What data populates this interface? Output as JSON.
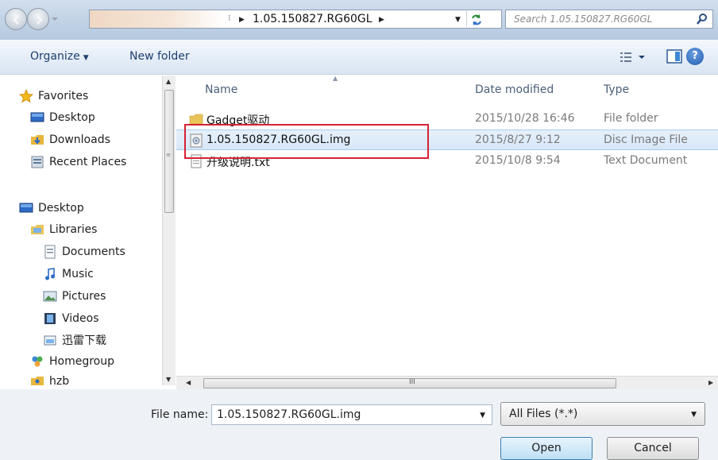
{
  "address": {
    "overflow_glyph": "⁝",
    "current_folder": "1.05.150827.RG60GL"
  },
  "search": {
    "placeholder": "Search 1.05.150827.RG60GL"
  },
  "toolbar": {
    "organize_label": "Organize",
    "new_folder_label": "New folder",
    "help_label": "?"
  },
  "nav": {
    "favorites": "Favorites",
    "fav_desktop": "Desktop",
    "downloads": "Downloads",
    "recent_places": "Recent Places",
    "desktop": "Desktop",
    "libraries": "Libraries",
    "documents": "Documents",
    "music": "Music",
    "pictures": "Pictures",
    "videos": "Videos",
    "xunlei": "迅雷下载",
    "homegroup": "Homegroup",
    "user": "hzb"
  },
  "columns": {
    "name": "Name",
    "date": "Date modified",
    "type": "Type"
  },
  "files": [
    {
      "name": "Gadget驱动",
      "date": "2015/10/28 16:46",
      "type": "File folder",
      "icon": "folder-icon"
    },
    {
      "name": "1.05.150827.RG60GL.img",
      "date": "2015/8/27 9:12",
      "type": "Disc Image File",
      "icon": "disc-image-icon",
      "selected": true
    },
    {
      "name": "升级说明.txt",
      "date": "2015/10/8 9:54",
      "type": "Text Document",
      "icon": "text-file-icon"
    }
  ],
  "hscroll_grip": "III",
  "bottom": {
    "filename_label": "File name:",
    "filename_value": "1.05.150827.RG60GL.img",
    "filetype_value": "All Files (*.*)",
    "open_label": "Open",
    "cancel_label": "Cancel"
  },
  "colors": {
    "highlight_border": "#d62235",
    "selection": "#d7e7f8",
    "link_blue": "#1e3f6f"
  }
}
